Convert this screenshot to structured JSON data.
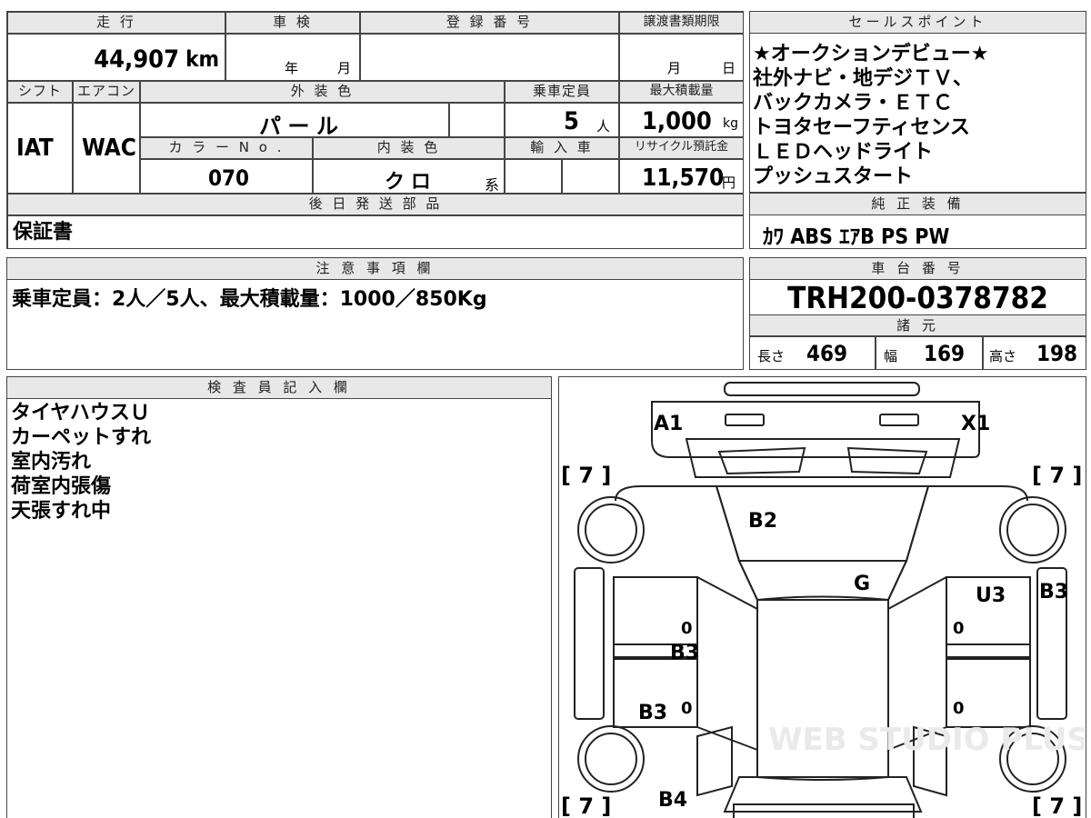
{
  "vehicle_info": {
    "mileage_label": "走 行",
    "mileage_value": "44,907",
    "mileage_unit": "km",
    "inspection_label": "車 検",
    "inspection_year": "年",
    "inspection_month": "月",
    "registration_label": "登 録 番 号",
    "transfer_label": "譲渡書類期限",
    "transfer_month": "月",
    "transfer_day": "日",
    "shift_label": "シフト",
    "shift_value": "IAT",
    "aircon_label": "エアコン",
    "aircon_value": "WAC",
    "exterior_color_label": "外 装 色",
    "exterior_color_value": "パ ー ル",
    "capacity_label": "乗車定員",
    "capacity_value": "5",
    "capacity_unit": "人",
    "max_load_label": "最大積載量",
    "max_load_value": "1,000",
    "max_load_unit": "kg",
    "color_no_label": "カ ラ ー N o .",
    "color_no_value": "070",
    "interior_color_label": "内 装 色",
    "interior_color_value": "ク ロ",
    "interior_color_suffix": "系",
    "import_label": "輸 入 車",
    "recycle_label": "リサイクル預託金",
    "recycle_value": "11,570",
    "recycle_unit": "円",
    "later_parts_label": "後 日 発 送 部 品",
    "later_parts_value": "保証書"
  },
  "sales_points": {
    "label": "セールスポイント",
    "lines": [
      "★オークションデビュー★",
      "社外ナビ・地デジＴＶ、",
      "バックカメラ・ＥＴＣ",
      "トヨタセーフティセンス",
      "ＬＥＤヘッドライト",
      "プッシュスタート"
    ]
  },
  "equipment": {
    "label": "純 正 装 備",
    "value": "ｶﾜ ABS ｴｱB PS PW"
  },
  "notes": {
    "label": "注 意 事 項 欄",
    "value": "乗車定員：2人／5人、最大積載量：1000／850Kg"
  },
  "chassis": {
    "label": "車 台 番 号",
    "value": "TRH200-0378782",
    "spec_label": "諸 元",
    "length_label": "長さ",
    "length_value": "469",
    "width_label": "幅",
    "width_value": "169",
    "height_label": "高さ",
    "height_value": "198"
  },
  "inspector": {
    "label": "検 査 員 記 入 欄",
    "lines": [
      "タイヤハウスＵ",
      "カーペットすれ",
      "室内汚れ",
      "荷室内張傷",
      "天張すれ中"
    ]
  },
  "diagram": {
    "tread_fl": "[ 7 ]",
    "tread_fr": "[ 7 ]",
    "tread_rl": "[ 7 ]",
    "tread_rr": "[ 7 ]",
    "marks": {
      "a1": "A1",
      "x1": "X1",
      "b2": "B2",
      "g": "G",
      "u3": "U3",
      "b3_right": "B3",
      "b3_left_door": "B3",
      "b3_left_rear": "B3",
      "b4": "B4"
    },
    "zero": "0",
    "watermark": "WEB STUDIO PLUS"
  }
}
